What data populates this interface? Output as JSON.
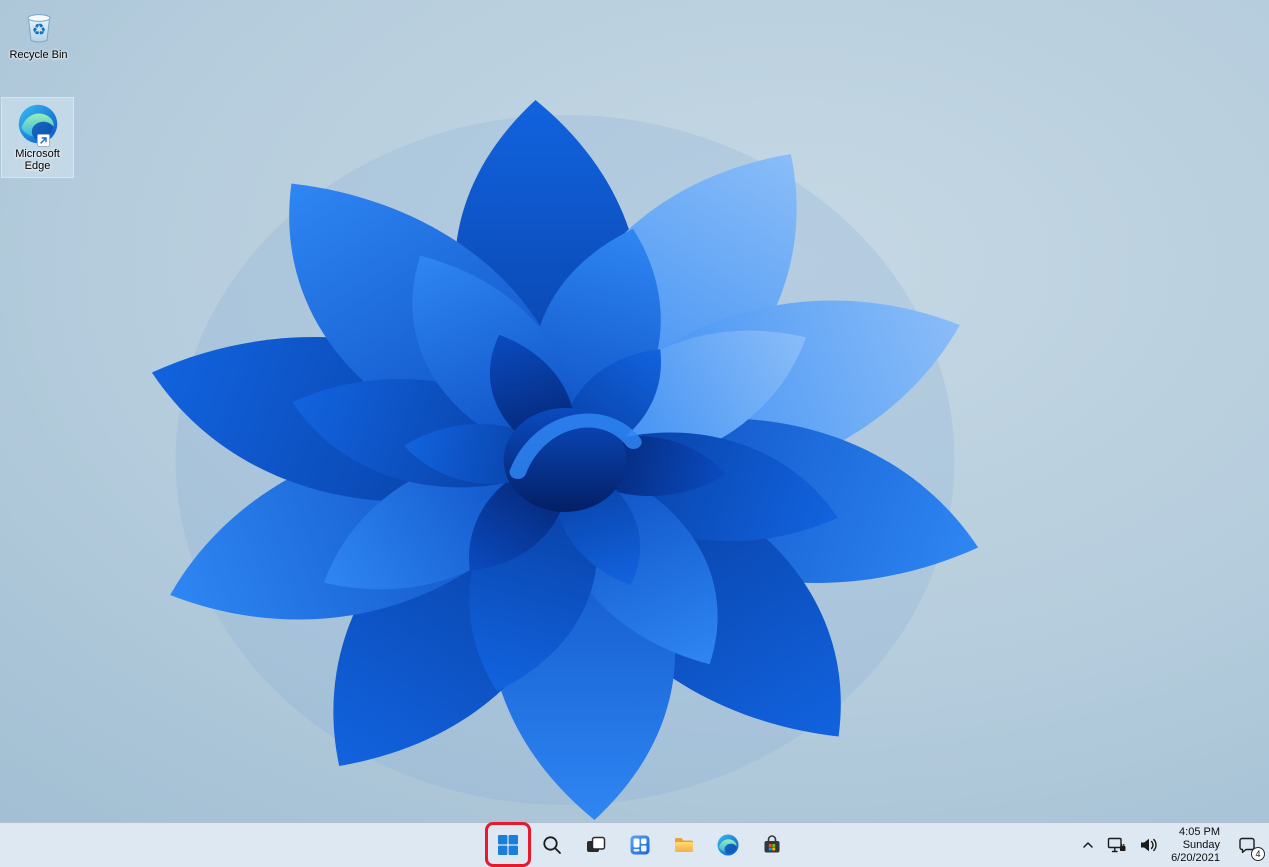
{
  "desktop": {
    "icons": [
      {
        "name": "recycle-bin",
        "label": "Recycle Bin",
        "selected": false
      },
      {
        "name": "microsoft-edge",
        "label": "Microsoft Edge",
        "selected": true
      }
    ]
  },
  "taskbar": {
    "buttons": [
      {
        "icon": "windows-start-icon",
        "label": "Start"
      },
      {
        "icon": "search-icon",
        "label": "Search"
      },
      {
        "icon": "task-view-icon",
        "label": "Task View"
      },
      {
        "icon": "widgets-icon",
        "label": "Widgets"
      },
      {
        "icon": "file-explorer-icon",
        "label": "File Explorer"
      },
      {
        "icon": "edge-icon",
        "label": "Microsoft Edge"
      },
      {
        "icon": "store-icon",
        "label": "Microsoft Store"
      }
    ],
    "tray": {
      "chevron_icon": "chevron-up-icon",
      "network_icon": "network-icon",
      "volume_icon": "volume-icon",
      "clock": {
        "time": "4:05 PM",
        "day": "Sunday",
        "date": "6/20/2021"
      },
      "notifications": {
        "icon": "notification-icon",
        "badge_count": "4"
      }
    }
  },
  "annotation": {
    "shape": "rounded-rectangle-highlight",
    "target": "start-button",
    "color": "#e8192c"
  },
  "colors": {
    "taskbar_bg": "#dde8f2",
    "wallpaper_bg": "#b3cadb",
    "bloom_blue": "#1668e3",
    "bloom_dark": "#083a9e"
  }
}
